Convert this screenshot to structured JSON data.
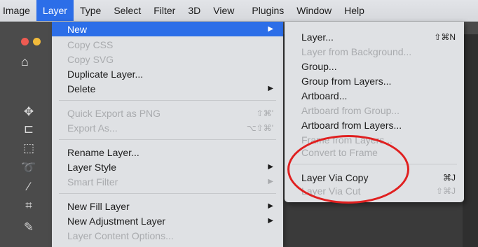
{
  "menubar": {
    "items": [
      {
        "label": "Image"
      },
      {
        "label": "Layer",
        "active": true
      },
      {
        "label": "Type"
      },
      {
        "label": "Select"
      },
      {
        "label": "Filter"
      },
      {
        "label": "3D"
      },
      {
        "label": "View"
      },
      {
        "label": "Plugins"
      },
      {
        "label": "Window"
      },
      {
        "label": "Help"
      }
    ]
  },
  "layer_menu": {
    "new": {
      "label": "New"
    },
    "copy_css": {
      "label": "Copy CSS"
    },
    "copy_svg": {
      "label": "Copy SVG"
    },
    "duplicate_layer": {
      "label": "Duplicate Layer..."
    },
    "delete": {
      "label": "Delete"
    },
    "quick_export": {
      "label": "Quick Export as PNG",
      "shortcut": "⇧⌘'"
    },
    "export_as": {
      "label": "Export As...",
      "shortcut": "⌥⇧⌘'"
    },
    "rename_layer": {
      "label": "Rename Layer..."
    },
    "layer_style": {
      "label": "Layer Style"
    },
    "smart_filter": {
      "label": "Smart Filter"
    },
    "new_fill_layer": {
      "label": "New Fill Layer"
    },
    "new_adjustment_layer": {
      "label": "New Adjustment Layer"
    },
    "layer_content_options": {
      "label": "Layer Content Options..."
    }
  },
  "new_submenu": {
    "layer": {
      "label": "Layer...",
      "shortcut": "⇧⌘N"
    },
    "layer_from_background": {
      "label": "Layer from Background..."
    },
    "group": {
      "label": "Group..."
    },
    "group_from_layers": {
      "label": "Group from Layers..."
    },
    "artboard": {
      "label": "Artboard..."
    },
    "artboard_from_group": {
      "label": "Artboard from Group..."
    },
    "artboard_from_layers": {
      "label": "Artboard from Layers..."
    },
    "frame_from_layers": {
      "label": "Frame from Layers..."
    },
    "convert_to_frame": {
      "label": "Convert to Frame"
    },
    "layer_via_copy": {
      "label": "Layer Via Copy",
      "shortcut": "⌘J"
    },
    "layer_via_cut": {
      "label": "Layer Via Cut",
      "shortcut": "⇧⌘J"
    }
  },
  "colors": {
    "highlight": "#2c6ee8",
    "annotation_ring": "#e02020"
  },
  "icons": [
    "home-icon",
    "move-tool-icon",
    "artboard-tool-icon",
    "marquee-tool-icon",
    "lasso-tool-icon",
    "magic-wand-icon",
    "crop-tool-icon",
    "eyedropper-icon",
    "chevron-right-icon"
  ]
}
